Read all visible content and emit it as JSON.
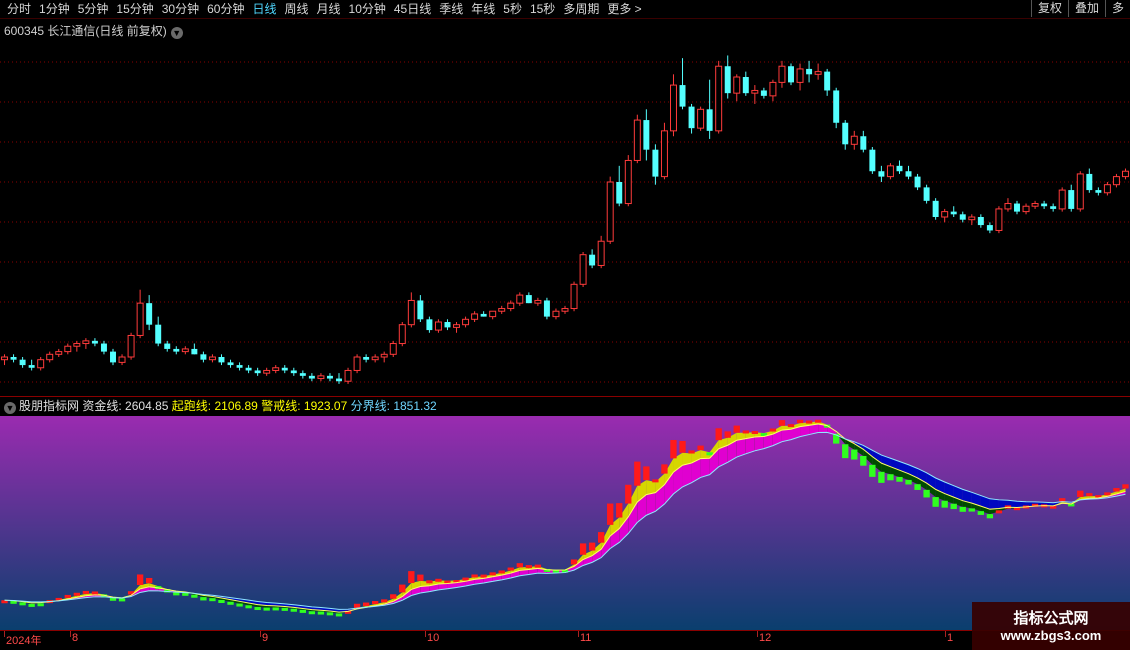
{
  "toolbar": {
    "items": [
      "分时",
      "1分钟",
      "5分钟",
      "15分钟",
      "30分钟",
      "60分钟",
      "日线",
      "周线",
      "月线",
      "10分钟",
      "45日线",
      "季线",
      "年线",
      "5秒",
      "15秒",
      "多周期",
      "更多 >"
    ],
    "active_index": 6,
    "right_buttons": [
      "复权",
      "叠加",
      "多"
    ]
  },
  "price_panel": {
    "title": "600345 长江通信(日线 前复权)"
  },
  "indicator_panel": {
    "name": "股朋指标网",
    "zj_label": "资金线:",
    "zj_value": "2604.85",
    "qp_label": "起跑线:",
    "qp_value": "2106.89",
    "jj_label": "警戒线:",
    "jj_value": "1923.07",
    "fj_label": "分界线:",
    "fj_value": "1851.32"
  },
  "date_axis": {
    "labels": [
      "2024年",
      "8",
      "9",
      "10",
      "11",
      "12",
      "1"
    ]
  },
  "watermark": {
    "title": "指标公式网",
    "url": "www.zbgs3.com"
  },
  "colors": {
    "up": "#ff3b3b",
    "down": "#54ffff",
    "grid": "#8a0000",
    "bg_top": "#9a2bb0",
    "bg_bottom": "#0a3f6e",
    "gold": "#d6d600",
    "magenta": "#e000d0",
    "blue": "#0008c0",
    "green": "#2fff1f",
    "darkgreen": "#004a00"
  },
  "chart_data": {
    "type": "candlestick",
    "candles": [
      [
        10.2,
        10.4,
        10.0,
        10.3
      ],
      [
        10.3,
        10.4,
        10.1,
        10.2
      ],
      [
        10.2,
        10.3,
        9.9,
        10.0
      ],
      [
        10.0,
        10.2,
        9.8,
        9.9
      ],
      [
        9.9,
        10.3,
        9.8,
        10.2
      ],
      [
        10.2,
        10.5,
        10.1,
        10.4
      ],
      [
        10.4,
        10.6,
        10.3,
        10.5
      ],
      [
        10.5,
        10.8,
        10.4,
        10.7
      ],
      [
        10.7,
        10.9,
        10.5,
        10.8
      ],
      [
        10.8,
        11.0,
        10.6,
        10.9
      ],
      [
        10.9,
        11.0,
        10.7,
        10.8
      ],
      [
        10.8,
        10.9,
        10.4,
        10.5
      ],
      [
        10.5,
        10.6,
        10.0,
        10.1
      ],
      [
        10.1,
        10.4,
        10.0,
        10.3
      ],
      [
        10.3,
        11.2,
        10.2,
        11.1
      ],
      [
        11.1,
        12.8,
        11.0,
        12.3
      ],
      [
        12.3,
        12.6,
        11.3,
        11.5
      ],
      [
        11.5,
        11.8,
        10.7,
        10.8
      ],
      [
        10.8,
        10.9,
        10.5,
        10.6
      ],
      [
        10.6,
        10.7,
        10.4,
        10.5
      ],
      [
        10.5,
        10.7,
        10.4,
        10.6
      ],
      [
        10.6,
        10.8,
        10.4,
        10.4
      ],
      [
        10.4,
        10.5,
        10.1,
        10.2
      ],
      [
        10.2,
        10.4,
        10.1,
        10.3
      ],
      [
        10.3,
        10.4,
        10.0,
        10.1
      ],
      [
        10.1,
        10.2,
        9.9,
        10.0
      ],
      [
        10.0,
        10.1,
        9.8,
        9.9
      ],
      [
        9.9,
        10.0,
        9.7,
        9.8
      ],
      [
        9.8,
        9.9,
        9.6,
        9.7
      ],
      [
        9.7,
        9.9,
        9.6,
        9.8
      ],
      [
        9.8,
        10.0,
        9.7,
        9.9
      ],
      [
        9.9,
        10.0,
        9.7,
        9.8
      ],
      [
        9.8,
        9.9,
        9.6,
        9.7
      ],
      [
        9.7,
        9.8,
        9.5,
        9.6
      ],
      [
        9.6,
        9.7,
        9.4,
        9.5
      ],
      [
        9.5,
        9.7,
        9.4,
        9.6
      ],
      [
        9.6,
        9.7,
        9.4,
        9.5
      ],
      [
        9.5,
        9.7,
        9.3,
        9.4
      ],
      [
        9.4,
        9.9,
        9.3,
        9.8
      ],
      [
        9.8,
        10.4,
        9.7,
        10.3
      ],
      [
        10.3,
        10.4,
        10.1,
        10.2
      ],
      [
        10.2,
        10.4,
        10.1,
        10.3
      ],
      [
        10.3,
        10.5,
        10.1,
        10.4
      ],
      [
        10.4,
        10.9,
        10.3,
        10.8
      ],
      [
        10.8,
        11.6,
        10.7,
        11.5
      ],
      [
        11.5,
        12.7,
        11.4,
        12.4
      ],
      [
        12.4,
        12.6,
        11.6,
        11.7
      ],
      [
        11.7,
        11.8,
        11.2,
        11.3
      ],
      [
        11.3,
        11.7,
        11.2,
        11.6
      ],
      [
        11.6,
        11.7,
        11.3,
        11.4
      ],
      [
        11.4,
        11.6,
        11.2,
        11.5
      ],
      [
        11.5,
        11.8,
        11.4,
        11.7
      ],
      [
        11.7,
        12.0,
        11.6,
        11.9
      ],
      [
        11.9,
        12.0,
        11.8,
        11.8
      ],
      [
        11.8,
        12.0,
        11.7,
        12.0
      ],
      [
        12.0,
        12.2,
        11.9,
        12.1
      ],
      [
        12.1,
        12.4,
        12.0,
        12.3
      ],
      [
        12.3,
        12.7,
        12.2,
        12.6
      ],
      [
        12.6,
        12.7,
        12.3,
        12.3
      ],
      [
        12.3,
        12.5,
        12.2,
        12.4
      ],
      [
        12.4,
        12.5,
        11.7,
        11.8
      ],
      [
        11.8,
        12.1,
        11.7,
        12.0
      ],
      [
        12.0,
        12.2,
        11.9,
        12.1
      ],
      [
        12.1,
        13.1,
        12.0,
        13.0
      ],
      [
        13.0,
        14.2,
        12.9,
        14.1
      ],
      [
        14.1,
        14.3,
        13.6,
        13.7
      ],
      [
        13.7,
        14.8,
        13.6,
        14.6
      ],
      [
        14.6,
        17.0,
        14.5,
        16.8
      ],
      [
        16.8,
        17.4,
        15.9,
        16.0
      ],
      [
        16.0,
        17.8,
        15.9,
        17.6
      ],
      [
        17.6,
        19.3,
        17.5,
        19.1
      ],
      [
        19.1,
        19.5,
        17.6,
        18.0
      ],
      [
        18.0,
        18.2,
        16.7,
        17.0
      ],
      [
        17.0,
        19.0,
        16.9,
        18.7
      ],
      [
        18.7,
        20.8,
        18.5,
        20.4
      ],
      [
        20.4,
        21.4,
        19.5,
        19.6
      ],
      [
        19.6,
        19.7,
        18.6,
        18.8
      ],
      [
        18.8,
        19.6,
        18.7,
        19.5
      ],
      [
        19.5,
        20.6,
        18.4,
        18.7
      ],
      [
        18.7,
        21.3,
        18.6,
        21.1
      ],
      [
        21.1,
        21.5,
        19.9,
        20.1
      ],
      [
        20.1,
        20.8,
        19.8,
        20.7
      ],
      [
        20.7,
        20.9,
        20.0,
        20.1
      ],
      [
        20.1,
        20.4,
        19.7,
        20.2
      ],
      [
        20.2,
        20.3,
        19.9,
        20.0
      ],
      [
        20.0,
        20.6,
        19.8,
        20.5
      ],
      [
        20.5,
        21.3,
        20.3,
        21.1
      ],
      [
        21.1,
        21.2,
        20.4,
        20.5
      ],
      [
        20.5,
        21.2,
        20.2,
        21.0
      ],
      [
        21.0,
        21.3,
        20.5,
        20.8
      ],
      [
        20.8,
        21.2,
        20.6,
        20.9
      ],
      [
        20.9,
        21.0,
        20.0,
        20.2
      ],
      [
        20.2,
        20.3,
        18.8,
        19.0
      ],
      [
        19.0,
        19.1,
        18.0,
        18.2
      ],
      [
        18.2,
        18.7,
        18.0,
        18.5
      ],
      [
        18.5,
        18.7,
        17.9,
        18.0
      ],
      [
        18.0,
        18.1,
        17.1,
        17.2
      ],
      [
        17.2,
        17.4,
        16.8,
        17.0
      ],
      [
        17.0,
        17.5,
        16.9,
        17.4
      ],
      [
        17.4,
        17.6,
        17.1,
        17.2
      ],
      [
        17.2,
        17.4,
        16.9,
        17.0
      ],
      [
        17.0,
        17.1,
        16.5,
        16.6
      ],
      [
        16.6,
        16.7,
        16.0,
        16.1
      ],
      [
        16.1,
        16.2,
        15.4,
        15.5
      ],
      [
        15.5,
        15.8,
        15.3,
        15.7
      ],
      [
        15.7,
        15.9,
        15.5,
        15.6
      ],
      [
        15.6,
        15.7,
        15.3,
        15.4
      ],
      [
        15.4,
        15.6,
        15.2,
        15.5
      ],
      [
        15.5,
        15.6,
        15.1,
        15.2
      ],
      [
        15.2,
        15.3,
        14.9,
        15.0
      ],
      [
        15.0,
        15.9,
        14.9,
        15.8
      ],
      [
        15.8,
        16.2,
        15.7,
        16.0
      ],
      [
        16.0,
        16.1,
        15.6,
        15.7
      ],
      [
        15.7,
        16.0,
        15.6,
        15.9
      ],
      [
        15.9,
        16.1,
        15.8,
        16.0
      ],
      [
        16.0,
        16.1,
        15.8,
        15.9
      ],
      [
        15.9,
        16.0,
        15.7,
        15.8
      ],
      [
        15.8,
        16.6,
        15.7,
        16.5
      ],
      [
        16.5,
        16.7,
        15.7,
        15.8
      ],
      [
        15.8,
        17.2,
        15.7,
        17.1
      ],
      [
        17.1,
        17.3,
        16.4,
        16.5
      ],
      [
        16.5,
        16.6,
        16.3,
        16.4
      ],
      [
        16.4,
        16.8,
        16.3,
        16.7
      ],
      [
        16.7,
        17.1,
        16.6,
        17.0
      ],
      [
        17.0,
        17.3,
        16.9,
        17.2
      ]
    ],
    "indicator": {
      "series": [
        "资金线",
        "起跑线",
        "警戒线",
        "分界线"
      ]
    }
  }
}
